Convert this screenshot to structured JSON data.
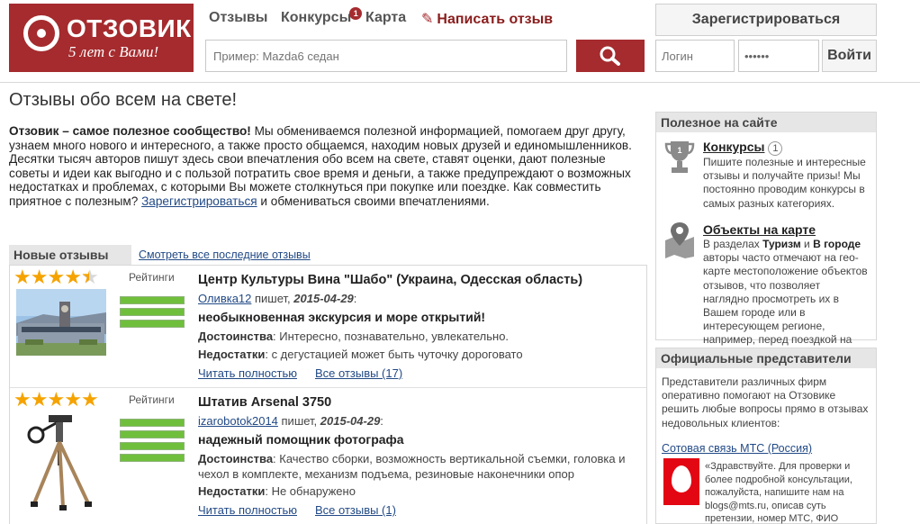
{
  "header": {
    "logo": {
      "brand": "ОТЗОВИК",
      "slogan": "5 лет с Вами!"
    },
    "nav": {
      "reviews": "Отзывы",
      "contests": "Конкурсы",
      "contests_badge": "1",
      "map": "Карта",
      "write": "Написать отзыв"
    },
    "search": {
      "placeholder": "Пример: Mazda6 седан"
    },
    "register_label": "Зарегистрироваться",
    "login": {
      "placeholder": "Логин",
      "password_value": "••••••",
      "button_label": "Войти"
    }
  },
  "main": {
    "title": "Отзывы обо всем на свете!",
    "intro": {
      "lead": "Отзовик – самое полезное сообщество!",
      "body": " Мы обмениваемся полезной информацией, помогаем друг другу, узнаем много нового и интересного, а также просто общаемся, находим новых друзей и единомышленников. Десятки тысяч авторов пишут здесь свои впечатления обо всем на свете, ставят оценки, дают полезные советы и идеи как выгодно и с пользой потратить свое время и деньги, а также предупреждают о возможных недостатках и проблемах, с которыми Вы можете столкнуться при покупке или поездке. Как совместить приятное с полезным? ",
      "link": "Зарегистрироваться",
      "tail": " и обмениваться своими впечатлениями."
    },
    "new_reviews_tab": "Новые отзывы",
    "all_latest_link": "Смотреть все последние отзывы",
    "reviews": [
      {
        "rating": 4.5,
        "ratings_label": "Рейтинги",
        "title": "Центр Культуры Вина \"Шабо\" (Украина, Одесская область)",
        "author": "Оливка12",
        "writes": " пишет, ",
        "date": "2015-04-29",
        "headline": "необыкновенная экскурсия и море открытий!",
        "pros_label": "Достоинства",
        "pros": ": Интересно, познавательно, увлекательно.",
        "cons_label": "Недостатки",
        "cons": ": с дегустацией может быть чуточку дороговато",
        "read_more": "Читать полностью",
        "all_reviews": "Все отзывы (17)"
      },
      {
        "rating": 5,
        "ratings_label": "Рейтинги",
        "title": "Штатив Arsenal 3750",
        "author": "izarobotok2014",
        "writes": " пишет, ",
        "date": "2015-04-29",
        "headline": "надежный помощник фотографа",
        "pros_label": "Достоинства",
        "pros": ": Качество сборки, возможность вертикальной съемки, головка и чехол в комплекте, механизм подъема, резиновые наконечники опор",
        "cons_label": "Недостатки",
        "cons": ": Не обнаружено",
        "read_more": "Читать полностью",
        "all_reviews": "Все отзывы (1)"
      }
    ]
  },
  "sidebar": {
    "useful": {
      "title": "Полезное на сайте",
      "contests": {
        "title": "Конкурсы",
        "count": "1",
        "text": "Пишите полезные и интересные отзывы и получайте призы! Мы постоянно проводим конкурсы в самых разных категориях."
      },
      "map": {
        "title": "Объекты на карте",
        "text_a": "В разделах ",
        "tourism": "Туризм",
        "text_b": " и ",
        "city": "В городе",
        "text_c": " авторы часто отмечают на гео-карте местоположение объектов отзывов, что позволяет наглядно просмотреть их в Вашем городе или в интересующем регионе, например, перед поездкой на отдых."
      }
    },
    "officials": {
      "title": "Официальные представители",
      "text": "Представители различных фирм оперативно помогают на Отзовике решить любые вопросы прямо в отзывах недовольных клиентов:",
      "mts_link": "Сотовая связь МТС (Россия)",
      "mts_quote": "«Здравствуйте. Для проверки и более подробной консультации, пожалуйста, напишите нам на blogs@mts.ru, описав суть претензии, номер МТС, ФИО владельца. С"
    }
  },
  "colors": {
    "brand": "#a52b2e",
    "link": "#224a86",
    "star": "#f5a300",
    "rating_bar": "#6fbf3c"
  }
}
